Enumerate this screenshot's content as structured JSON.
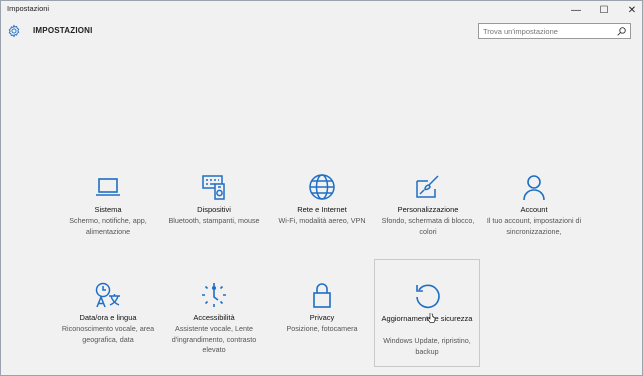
{
  "window": {
    "title": "Impostazioni",
    "controls": {
      "minimize": "—",
      "maximize": "☐",
      "close": "✕"
    }
  },
  "header": {
    "title": "IMPOSTAZIONI",
    "search_placeholder": "Trova un'impostazione"
  },
  "accent_color": "#1f6fc6",
  "tiles": [
    {
      "icon": "laptop-icon",
      "name": "Sistema",
      "desc": "Schermo, notifiche, app, alimentazione"
    },
    {
      "icon": "devices-icon",
      "name": "Dispositivi",
      "desc": "Bluetooth, stampanti, mouse"
    },
    {
      "icon": "globe-icon",
      "name": "Rete e Internet",
      "desc": "Wi-Fi, modalità aereo, VPN"
    },
    {
      "icon": "paint-icon",
      "name": "Personalizzazione",
      "desc": "Sfondo, schermata di blocco, colori"
    },
    {
      "icon": "person-icon",
      "name": "Account",
      "desc": "Il tuo account, impostazioni di sincronizzazione,"
    },
    {
      "icon": "language-icon",
      "name": "Data/ora e lingua",
      "desc": "Riconoscimento vocale, area geografica, data"
    },
    {
      "icon": "accessibility-icon",
      "name": "Accessibilità",
      "desc": "Assistente vocale, Lente d'ingrandimento, contrasto elevato"
    },
    {
      "icon": "lock-icon",
      "name": "Privacy",
      "desc": "Posizione, fotocamera"
    },
    {
      "icon": "update-icon",
      "name": "Aggiornamento e sicurezza",
      "desc": "Windows Update, ripristino, backup"
    }
  ]
}
